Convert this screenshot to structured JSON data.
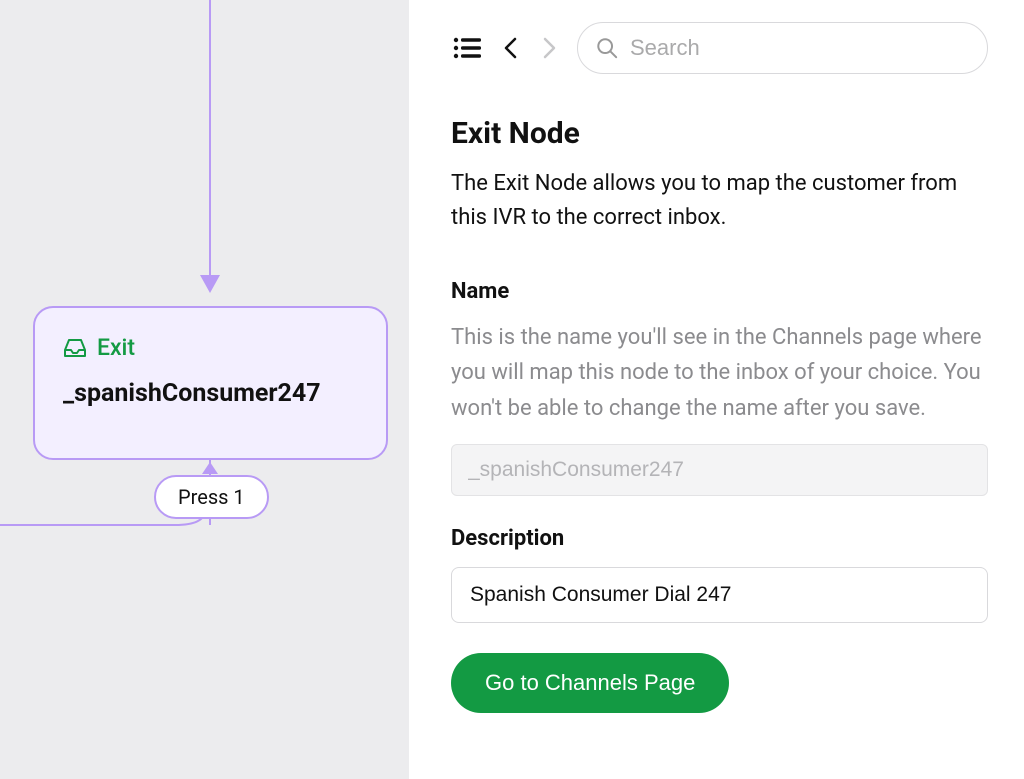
{
  "canvas": {
    "node": {
      "type_label": "Exit",
      "name": "_spanishConsumer247"
    },
    "press_badge": "Press 1"
  },
  "panel": {
    "search_placeholder": "Search",
    "title": "Exit Node",
    "description": "The Exit Node allows you to map the customer from this IVR to the correct inbox.",
    "name_section": {
      "label": "Name",
      "help": "This is the name you'll see in the Channels page where you will map this node to the inbox of your choice. You won't be able to change the name after you save.",
      "value": "_spanishConsumer247"
    },
    "description_section": {
      "label": "Description",
      "value": "Spanish Consumer Dial 247"
    },
    "cta_label": "Go to Channels Page"
  }
}
